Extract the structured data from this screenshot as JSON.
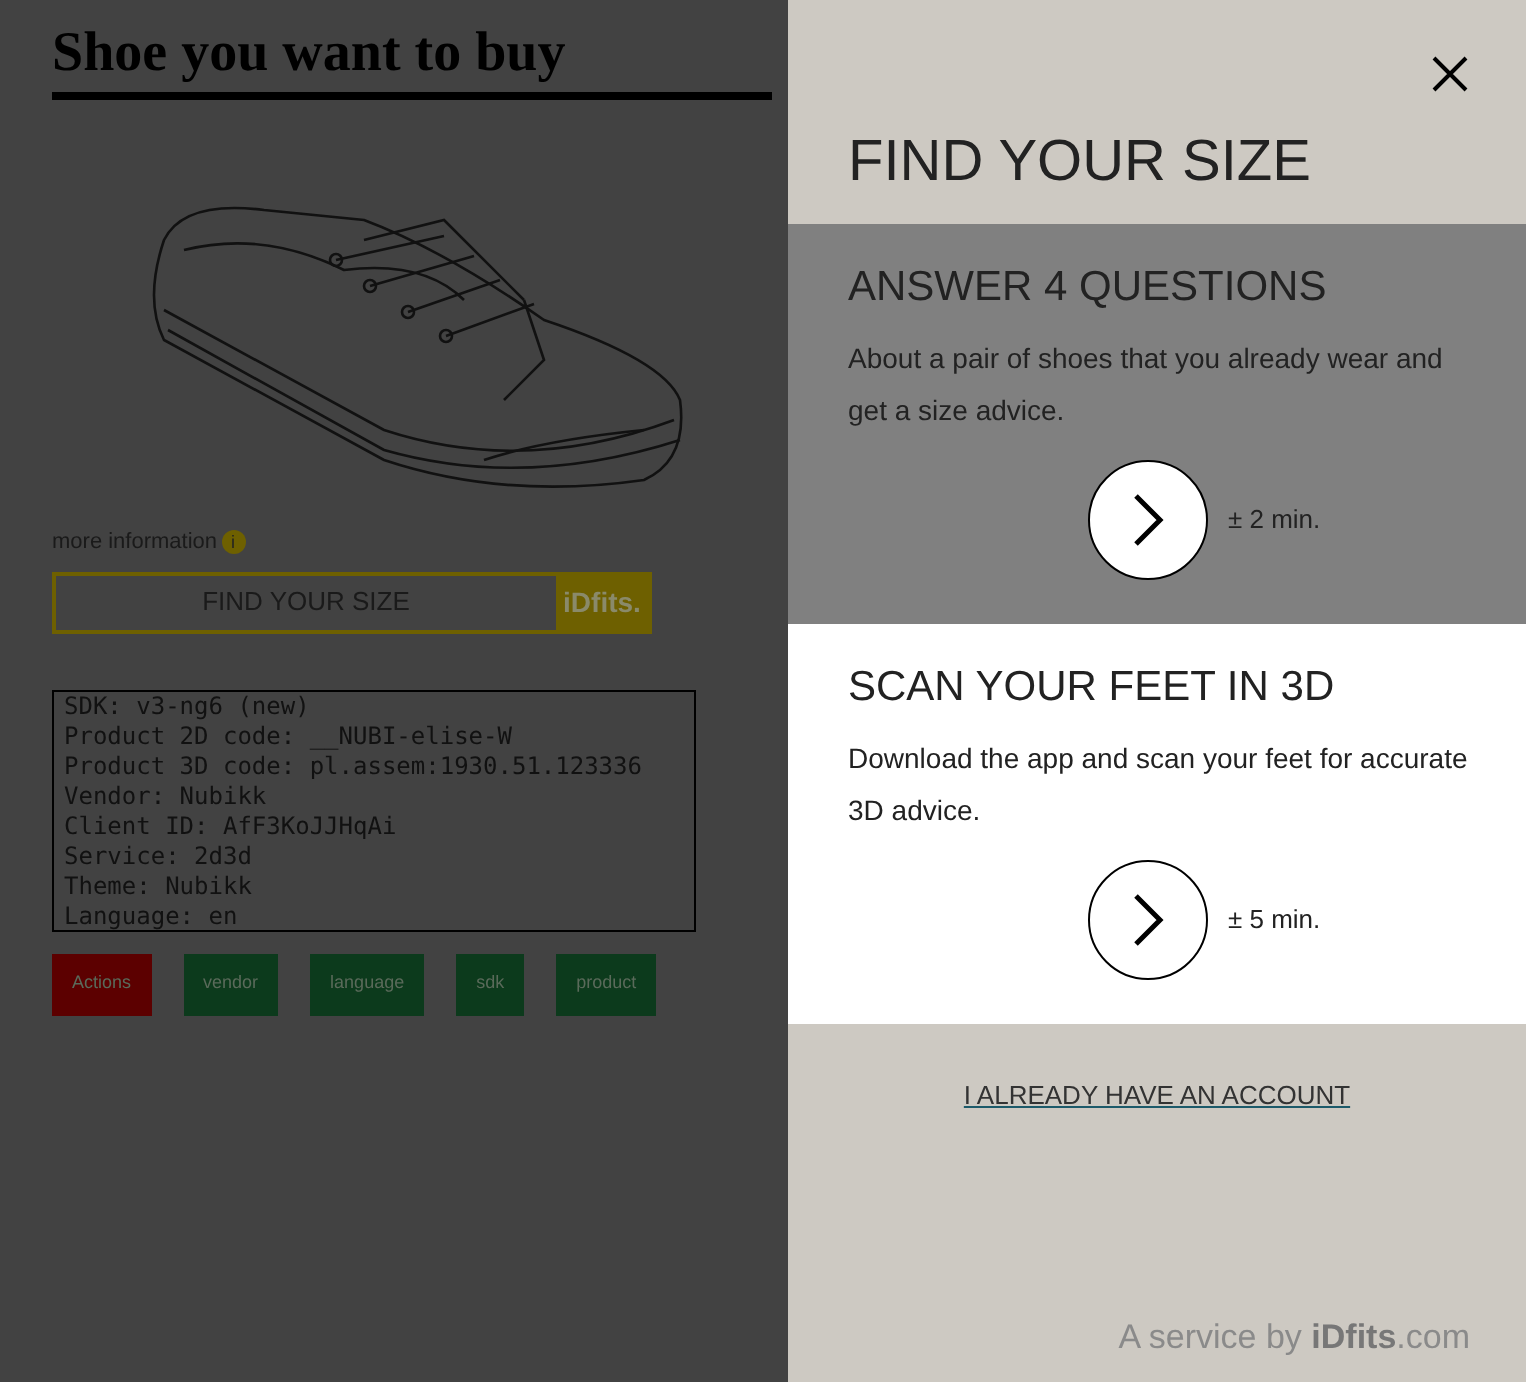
{
  "page": {
    "title": "Shoe you want to buy",
    "more_info": "more information",
    "info_icon": "i",
    "find_button": {
      "label": "FIND YOUR SIZE",
      "brand": "iDfits."
    },
    "debug_lines": [
      "SDK: v3-ng6 (new)",
      "Product 2D code: __NUBI-elise-W",
      "Product 3D code: pl.assem:1930.51.123336",
      "Vendor: Nubikk",
      "Client ID: AfF3KoJJHqAi",
      "Service: 2d3d",
      "Theme: Nubikk",
      "Language: en"
    ],
    "actions": [
      {
        "label": "Actions",
        "color": "#5c0000"
      },
      {
        "label": "vendor",
        "color": "#0c3a1c"
      },
      {
        "label": "language",
        "color": "#0c3a1c"
      },
      {
        "label": "sdk",
        "color": "#0c3a1c"
      },
      {
        "label": "product",
        "color": "#0c3a1c"
      }
    ]
  },
  "modal": {
    "title": "FIND YOUR SIZE",
    "options": [
      {
        "title": "ANSWER 4 QUESTIONS",
        "text": "About a pair of shoes that you already wear and get a size advice.",
        "duration": "± 2 min.",
        "selected": true
      },
      {
        "title": "SCAN YOUR FEET IN 3D",
        "text": "Download the app and scan your feet for accurate 3D advice.",
        "duration": "± 5 min.",
        "selected": false
      }
    ],
    "account_link": "I ALREADY HAVE AN ACCOUNT",
    "footer": "A service by **iDfits**.com"
  }
}
